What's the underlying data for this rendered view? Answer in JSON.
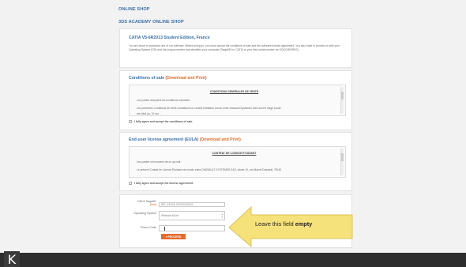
{
  "header": {
    "title1": "ONLINE SHOP",
    "title2": "3DS ACADEMY ONLINE SHOP"
  },
  "product": {
    "title": "CATIA V5-6R2013 Student Edition, France",
    "description": "You are about to purchase one of our software. Before doing so, you must accept the conditions of sale and the software license agreement. You also have to provide us with your Operating System (OS) and the unique number that identifies your computer (TargetID for CATIA or your disk serial number for SOLIDWORKS)."
  },
  "conditions": {
    "title": "Conditions of sale",
    "download": "(Download and Print)",
    "doc_heading": "CONDITIONS GENERALES DE VENTE",
    "line1": "Les parties acceptent les conditions suivantes :",
    "line2": "Les présentes Conditions de vente constituent un contrat forfaitaire conclu entre Dassault Systèmes SAS dont le siège social",
    "line3": "est situé au, 10 rue...",
    "agree": "I fully agree and accept the conditions of sale."
  },
  "eula": {
    "title": "End-user license agreement (EULA)",
    "download": "(Download and Print)",
    "doc_heading": "CONTRAT DE LICENCE ETUDIANT",
    "line1": "Les parties ont convenu de ce qui suit :",
    "line2": "Le présent Contrat de Licence Étudiant est conclu entre DASSAULT SYSTÈMES SAS, située 10, rue Marcel Dassault, 78140",
    "agree": "I fully agree and accept the license agreement."
  },
  "form": {
    "target_label": "DSLS TargetID",
    "target_req": "(hint)",
    "target_value": "DEL-XXXXX-XXXXXXXXXX",
    "os_label": "Operating System",
    "os_value": "Windows 64-bit",
    "promo_label": "Promo Code",
    "promo_value": "",
    "proceed": "» PROCEED"
  },
  "callout": {
    "text": "Leave this field ",
    "emph": "empty"
  },
  "colors": {
    "accent_blue": "#3a6fa8",
    "accent_orange": "#e56a2c",
    "callout_yellow": "#f6e27a"
  },
  "logo": {
    "letter": "K"
  }
}
